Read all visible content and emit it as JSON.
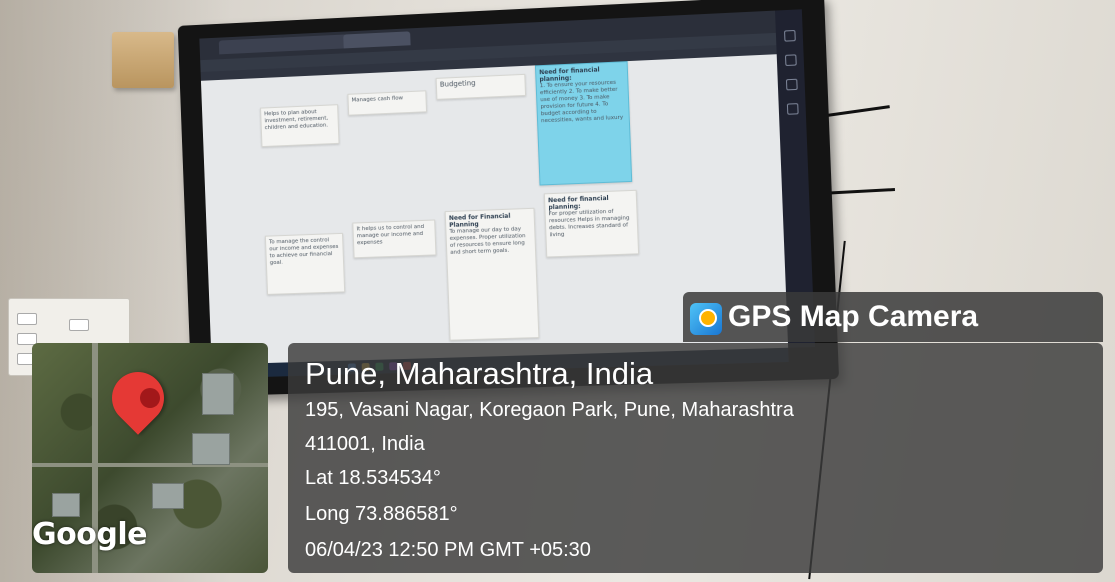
{
  "overlay": {
    "app_name": "GPS Map Camera",
    "location": "Pune, Maharashtra, India",
    "address_line1": "195, Vasani Nagar, Koregaon Park, Pune, Maharashtra",
    "address_line2": "411001, India",
    "latitude": "Lat 18.534534°",
    "longitude": "Long 73.886581°",
    "datetime": "06/04/23 12:50 PM GMT +05:30",
    "map_attribution": "Google"
  },
  "screen": {
    "notes_top": [
      {
        "text": "Helps to plan about investment, retirement, children and education."
      },
      {
        "text": "Manages cash flow"
      },
      {
        "text": "Budgeting"
      },
      {
        "title": "Need for financial planning:",
        "text": "1. To ensure your resources efficiently 2. To make better use of money 3. To make provision for future 4. To budget according to necessities, wants and luxury"
      }
    ],
    "notes_bottom": [
      {
        "text": "To manage the control our income and expenses to achieve our financial goal."
      },
      {
        "text": "It helps us to control and manage our income and expenses"
      },
      {
        "title": "Need for Financial Planning",
        "text": "To manage our day to day expenses. Proper utilization of resources to ensure long and short term goals."
      },
      {
        "title": "Need for financial planning:",
        "text": "For proper utilization of resources Helps in managing debts. Increases standard of living"
      }
    ]
  },
  "colors": {
    "overlay_bg": "#3a3a3a",
    "pin": "#e53935",
    "note_highlight": "#7ed3ea"
  },
  "icons": [
    "map-pin-icon",
    "gps-map-camera-icon"
  ]
}
